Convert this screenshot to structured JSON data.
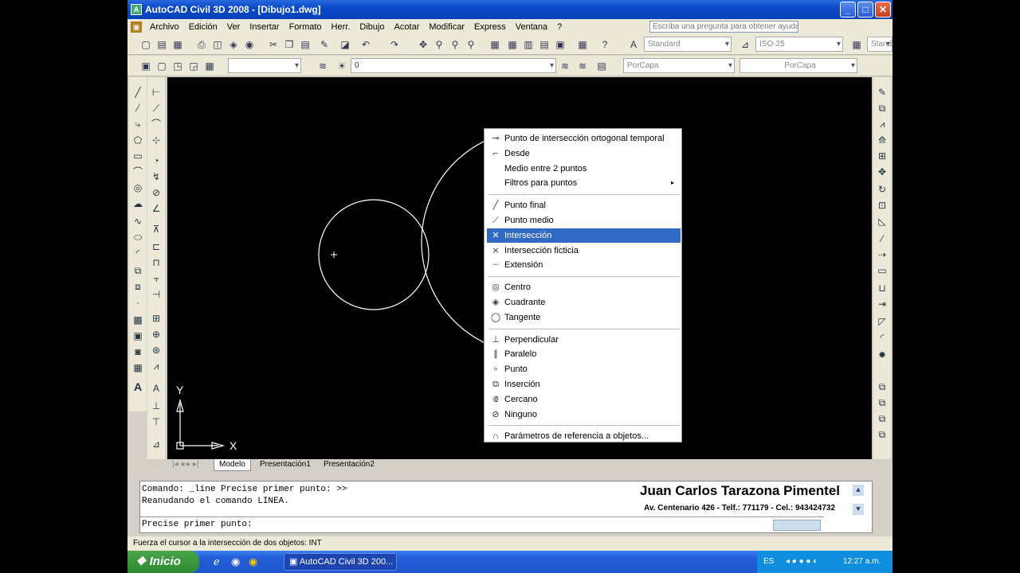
{
  "window": {
    "title": "AutoCAD Civil 3D 2008 - [Dibujo1.dwg]",
    "btn_min": "_",
    "btn_max": "□",
    "btn_close": "✕"
  },
  "menu": [
    "Archivo",
    "Edición",
    "Ver",
    "Insertar",
    "Formato",
    "Herr.",
    "Dibujo",
    "Acotar",
    "Modificar",
    "Express",
    "Ventana",
    "?"
  ],
  "help_placeholder": "Escriba una pregunta para obtener ayuda",
  "toolbar": {
    "text_style": "Standard",
    "dim_style": "ISO-25",
    "table_style": "Stand",
    "layer": "0",
    "color": "PorCapa",
    "linetype": "PorCapa"
  },
  "tabs": [
    "Modelo",
    "Presentación1",
    "Presentación2"
  ],
  "axes": {
    "x": "X",
    "y": "Y"
  },
  "context_menu": {
    "groups": [
      [
        {
          "label": "Punto de intersección ortogonal temporal",
          "icon": "tracking-icon"
        },
        {
          "label": "Desde",
          "icon": "from-icon"
        },
        {
          "label": "Medio entre 2 puntos",
          "icon": ""
        },
        {
          "label": "Filtros para puntos",
          "icon": "",
          "submenu": "▸"
        }
      ],
      [
        {
          "label": "Punto final",
          "icon": "endpoint-icon"
        },
        {
          "label": "Punto medio",
          "icon": "midpoint-icon"
        },
        {
          "label": "Intersección",
          "icon": "intersection-icon",
          "highlighted": true
        },
        {
          "label": "Intersección ficticia",
          "icon": "apparent-intersection-icon"
        },
        {
          "label": "Extensión",
          "icon": "extension-icon"
        }
      ],
      [
        {
          "label": "Centro",
          "icon": "center-icon"
        },
        {
          "label": "Cuadrante",
          "icon": "quadrant-icon"
        },
        {
          "label": "Tangente",
          "icon": "tangent-icon"
        }
      ],
      [
        {
          "label": "Perpendicular",
          "icon": "perpendicular-icon"
        },
        {
          "label": "Paralelo",
          "icon": "parallel-icon"
        },
        {
          "label": "Punto",
          "icon": "node-icon"
        },
        {
          "label": "Inserción",
          "icon": "insertion-icon"
        },
        {
          "label": "Cercano",
          "icon": "nearest-icon"
        },
        {
          "label": "Ninguno",
          "icon": "none-icon"
        }
      ],
      [
        {
          "label": "Parámetros de referencia a objetos...",
          "icon": "osnap-settings-icon"
        }
      ]
    ]
  },
  "command": {
    "line1": "Comando: _line Precise primer punto: >>",
    "line2": "Reanudando el comando LINEA.",
    "prompt": "Precise primer punto:"
  },
  "brand": {
    "name": "Juan Carlos Tarazona Pimentel",
    "address": "Av. Centenario 426 - Telf.: 771179 - Cel.: 943424732"
  },
  "status": "Fuerza el cursor a la intersección de dos objetos: INT",
  "taskbar": {
    "start": "Inicio",
    "task": "AutoCAD Civil 3D 200...",
    "lang": "ES",
    "clock": "12:27 a.m."
  }
}
